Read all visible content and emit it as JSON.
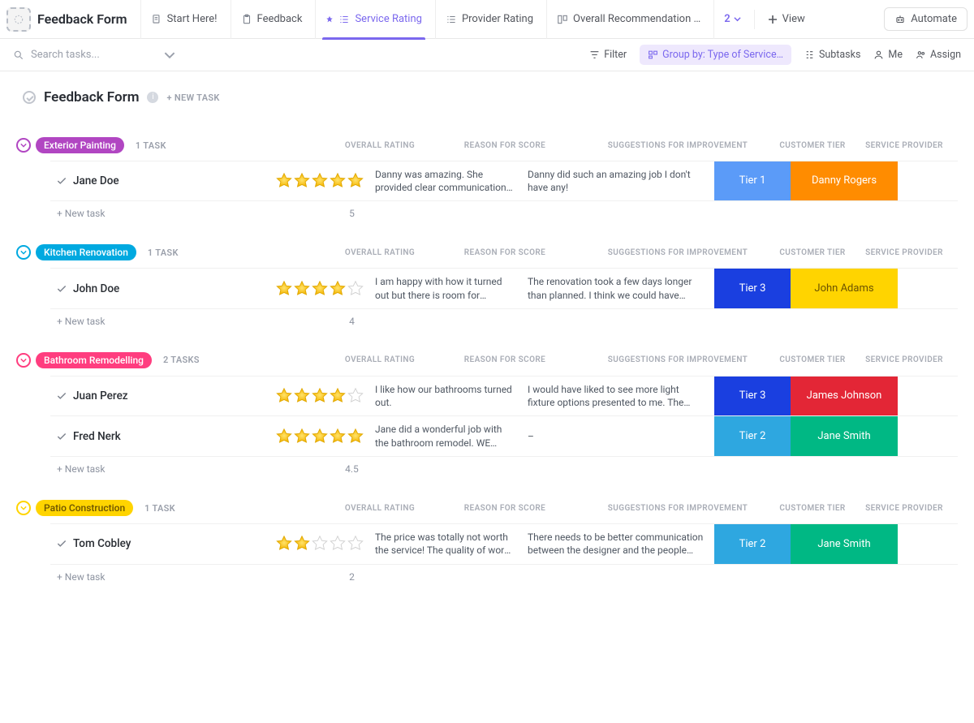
{
  "header": {
    "app_title": "Feedback Form",
    "tabs": [
      {
        "label": "Start Here!",
        "icon": "doc"
      },
      {
        "label": "Feedback",
        "icon": "clip"
      },
      {
        "label": "Service Rating",
        "icon": "list",
        "active": true,
        "pinned": true
      },
      {
        "label": "Provider Rating",
        "icon": "list"
      },
      {
        "label": "Overall Recommendation …",
        "icon": "board"
      }
    ],
    "hidden_views_count": "2",
    "add_view_label": "View",
    "automate_label": "Automate"
  },
  "toolbar": {
    "search_placeholder": "Search tasks...",
    "filter_label": "Filter",
    "group_label": "Group by: Type of Service…",
    "subtasks_label": "Subtasks",
    "me_label": "Me",
    "assign_label": "Assign"
  },
  "page": {
    "title": "Feedback Form",
    "new_task_label": "+ NEW TASK"
  },
  "columns": {
    "rating": "OVERALL RATING",
    "reason": "REASON FOR SCORE",
    "suggestions": "SUGGESTIONS FOR IMPROVEMENT",
    "tier": "CUSTOMER TIER",
    "provider": "SERVICE PROVIDER"
  },
  "colors": {
    "tier1": "#5b9bf8",
    "tier2": "#2ea7e0",
    "tier3": "#1a3fe0",
    "prov_danny": "#ff8c00",
    "prov_adams": "#ffd400",
    "prov_johnson": "#e32636",
    "prov_smith": "#00b884",
    "grp_exterior": "#b146c2",
    "grp_kitchen": "#00a9e0",
    "grp_bathroom": "#ff3d7f",
    "grp_patio": "#ffd400",
    "grp_patio_text": "#6b5200"
  },
  "groups": [
    {
      "name": "Exterior Painting",
      "color_key": "grp_exterior",
      "count": "1 TASK",
      "avg": "5",
      "rows": [
        {
          "name": "Jane Doe",
          "stars": 5,
          "reason": "Danny was amazing. She provided clear communication of time…",
          "sugg": "Danny did such an amazing job I don't have any!",
          "tier": "Tier 1",
          "tier_key": "tier1",
          "provider": "Danny Rogers",
          "prov_key": "prov_danny"
        }
      ]
    },
    {
      "name": "Kitchen Renovation",
      "color_key": "grp_kitchen",
      "count": "1 TASK",
      "avg": "4",
      "rows": [
        {
          "name": "John Doe",
          "stars": 4,
          "reason": "I am happy with how it turned out but there is room for improvement",
          "sugg": "The renovation took a few days longer than planned. I think we could have finished on …",
          "tier": "Tier 3",
          "tier_key": "tier3",
          "provider": "John Adams",
          "prov_key": "prov_adams",
          "prov_text_dark": true
        }
      ]
    },
    {
      "name": "Bathroom Remodelling",
      "color_key": "grp_bathroom",
      "count": "2 TASKS",
      "avg": "4.5",
      "rows": [
        {
          "name": "Juan Perez",
          "stars": 4,
          "reason": "I like how our bathrooms turned out.",
          "sugg": "I would have liked to see more light fixture options presented to me. The options provided…",
          "tier": "Tier 3",
          "tier_key": "tier3",
          "provider": "James Johnson",
          "prov_key": "prov_johnson"
        },
        {
          "name": "Fred Nerk",
          "stars": 5,
          "reason": "Jane did a wonderful job with the bathroom remodel. WE LOVE IT!",
          "sugg": "–",
          "tier": "Tier 2",
          "tier_key": "tier2",
          "provider": "Jane Smith",
          "prov_key": "prov_smith"
        }
      ]
    },
    {
      "name": "Patio Construction",
      "color_key": "grp_patio",
      "count": "1 TASK",
      "avg": "2",
      "text_key": "grp_patio_text",
      "rows": [
        {
          "name": "Tom Cobley",
          "stars": 2,
          "reason": "The price was totally not worth the service! The quality of work …",
          "sugg": "There needs to be better communication between the designer and the people doing the…",
          "tier": "Tier 2",
          "tier_key": "tier2",
          "provider": "Jane Smith",
          "prov_key": "prov_smith"
        }
      ]
    }
  ],
  "new_task_row": "+ New task"
}
